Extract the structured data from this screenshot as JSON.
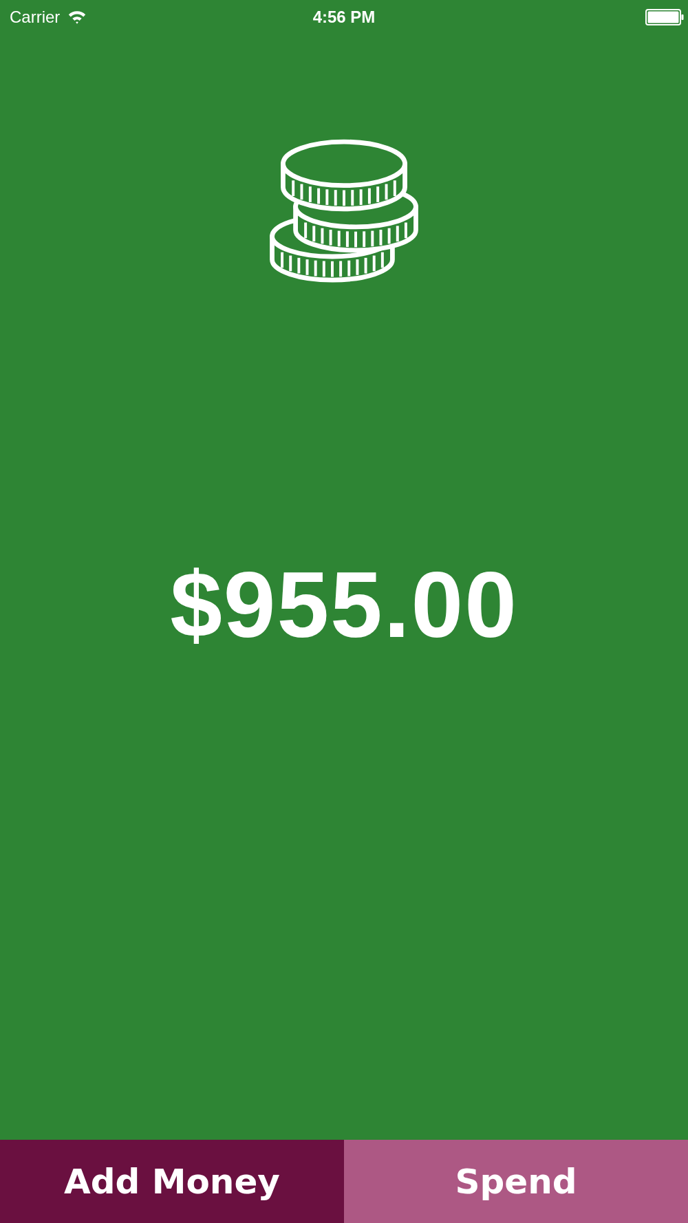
{
  "status_bar": {
    "carrier": "Carrier",
    "time": "4:56 PM"
  },
  "balance": "$955.00",
  "buttons": [
    {
      "label": "Add Money",
      "color": "#6a1040"
    },
    {
      "label": "Spend",
      "color": "#ad5884"
    }
  ]
}
